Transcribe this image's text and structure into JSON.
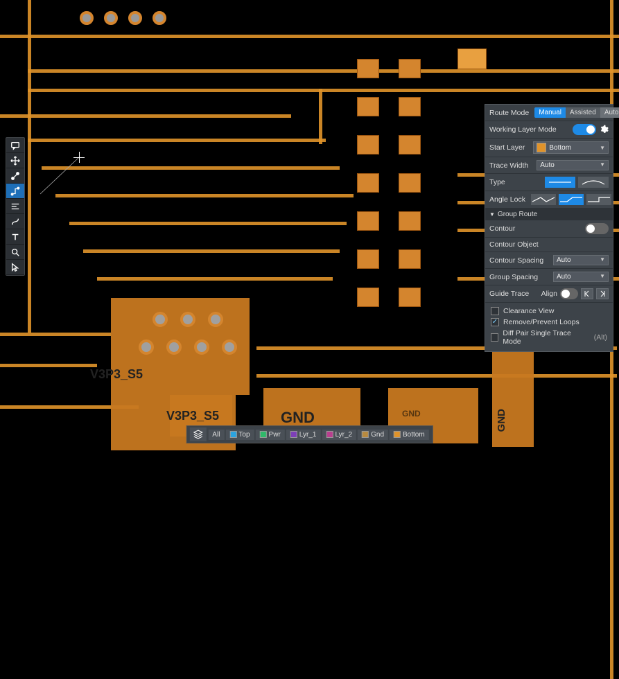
{
  "canvas": {
    "net_labels": [
      "V3P3_S5",
      "V3P3_S5",
      "GND",
      "GND",
      "GND"
    ]
  },
  "toolbar": {
    "tools": [
      "comment",
      "move",
      "connect",
      "route",
      "align",
      "path",
      "text",
      "zoom",
      "select"
    ]
  },
  "route_panel": {
    "title": "Route Mode",
    "modes": [
      "Manual",
      "Assisted",
      "Auto"
    ],
    "active_mode": "Manual",
    "working_layer_mode_label": "Working Layer Mode",
    "working_layer_mode": true,
    "start_layer_label": "Start Layer",
    "start_layer_value": "Bottom",
    "start_layer_color": "#e0932a",
    "trace_width_label": "Trace Width",
    "trace_width_value": "Auto",
    "type_label": "Type",
    "angle_lock_label": "Angle Lock",
    "group_route_label": "Group Route",
    "contour_label": "Contour",
    "contour_on": false,
    "contour_object_label": "Contour Object",
    "contour_spacing_label": "Contour Spacing",
    "contour_spacing_value": "Auto",
    "group_spacing_label": "Group Spacing",
    "group_spacing_value": "Auto",
    "guide_trace_label": "Guide Trace",
    "align_label": "Align",
    "align_on": false,
    "clearance_view": {
      "label": "Clearance View",
      "checked": false
    },
    "remove_loops": {
      "label": "Remove/Prevent Loops",
      "checked": true
    },
    "diff_pair": {
      "label": "Diff Pair Single Trace Mode",
      "checked": false,
      "shortcut": "(Alt)"
    }
  },
  "layers": {
    "all_label": "All",
    "items": [
      {
        "label": "Top",
        "color": "#2aa3e0"
      },
      {
        "label": "Pwr",
        "color": "#2fb96a"
      },
      {
        "label": "Lyr_1",
        "color": "#7d3fb8"
      },
      {
        "label": "Lyr_2",
        "color": "#b83f8f"
      },
      {
        "label": "Gnd",
        "color": "#b88a3f"
      },
      {
        "label": "Bottom",
        "color": "#e0932a"
      }
    ]
  }
}
